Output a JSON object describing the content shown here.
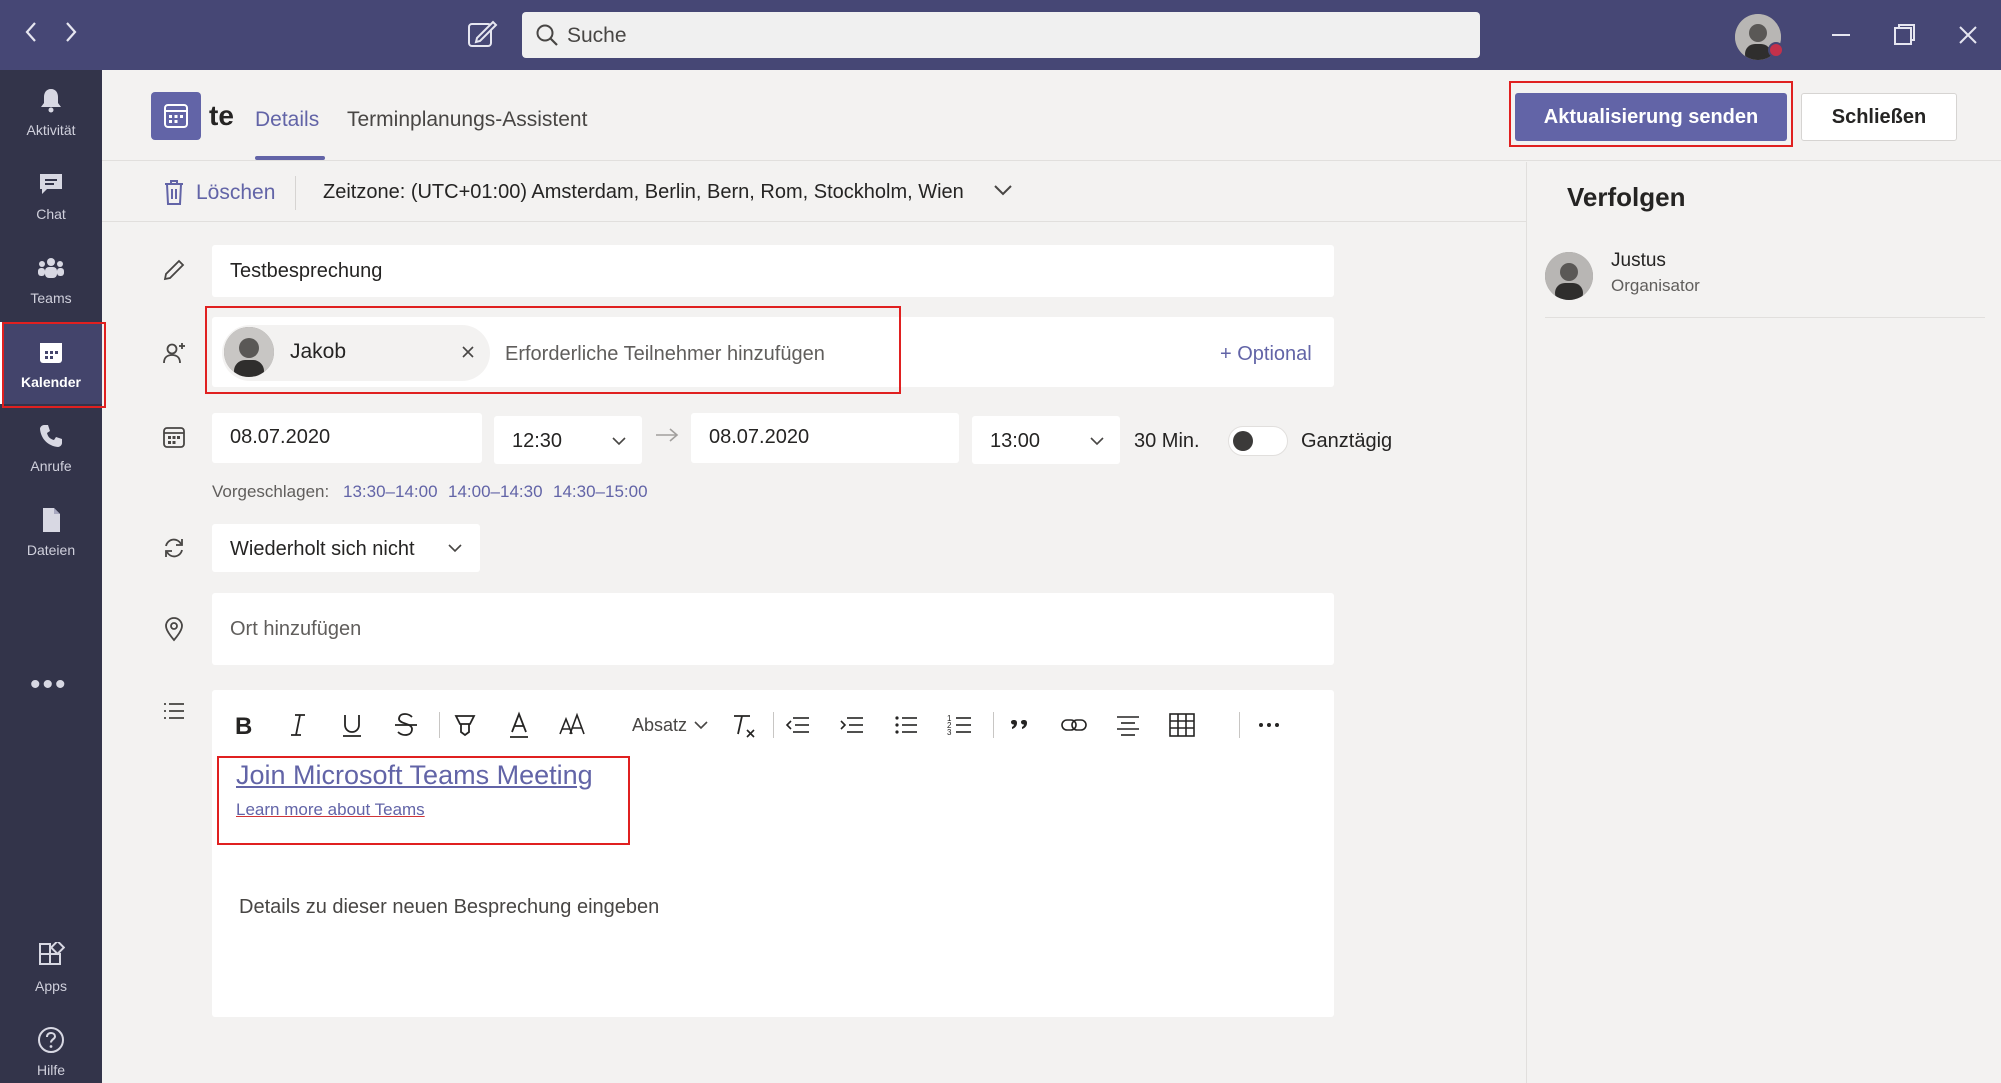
{
  "titlebar": {
    "back_icon": "chevron-left-icon",
    "forward_icon": "chevron-right-icon",
    "compose_icon": "compose-icon",
    "search_placeholder": "Suche",
    "status_color": "#c4314b"
  },
  "rail": {
    "items": [
      {
        "label": "Aktivität",
        "icon": "bell-icon"
      },
      {
        "label": "Chat",
        "icon": "chat-icon"
      },
      {
        "label": "Teams",
        "icon": "teams-icon"
      },
      {
        "label": "Kalender",
        "icon": "calendar-icon",
        "active": true
      },
      {
        "label": "Anrufe",
        "icon": "phone-icon"
      },
      {
        "label": "Dateien",
        "icon": "file-icon"
      },
      {
        "label": "Apps",
        "icon": "apps-icon"
      },
      {
        "label": "Hilfe",
        "icon": "help-icon"
      }
    ],
    "more": "•••"
  },
  "header": {
    "title": "te",
    "tabs": [
      {
        "label": "Details",
        "active": true
      },
      {
        "label": "Terminplanungs-Assistent"
      }
    ],
    "send_label": "Aktualisierung senden",
    "close_label": "Schließen",
    "accent": "#6264a7"
  },
  "subbar": {
    "delete_label": "Löschen",
    "timezone": "Zeitzone: (UTC+01:00) Amsterdam, Berlin, Bern, Rom, Stockholm, Wien"
  },
  "form": {
    "title_value": "Testbesprechung",
    "attendee_name": "Jakob",
    "attendee_placeholder": "Erforderliche Teilnehmer hinzufügen",
    "optional_label": "+ Optional",
    "start_date": "08.07.2020",
    "start_time": "12:30",
    "end_date": "08.07.2020",
    "end_time": "13:00",
    "duration": "30 Min.",
    "allday_label": "Ganztägig",
    "allday_on": false,
    "suggested_label": "Vorgeschlagen:",
    "suggested": [
      "13:30–14:00",
      "14:00–14:30",
      "14:30–15:00"
    ],
    "repeat_value": "Wiederholt sich nicht",
    "location_placeholder": "Ort hinzufügen"
  },
  "editor": {
    "paragraph_label": "Absatz",
    "join_link": "Join Microsoft Teams Meeting",
    "learn_more": "Learn more about Teams",
    "details_placeholder": "Details zu dieser neuen Besprechung eingeben"
  },
  "right_panel": {
    "title": "Verfolgen",
    "person_name": "Justus",
    "person_role": "Organisator"
  }
}
